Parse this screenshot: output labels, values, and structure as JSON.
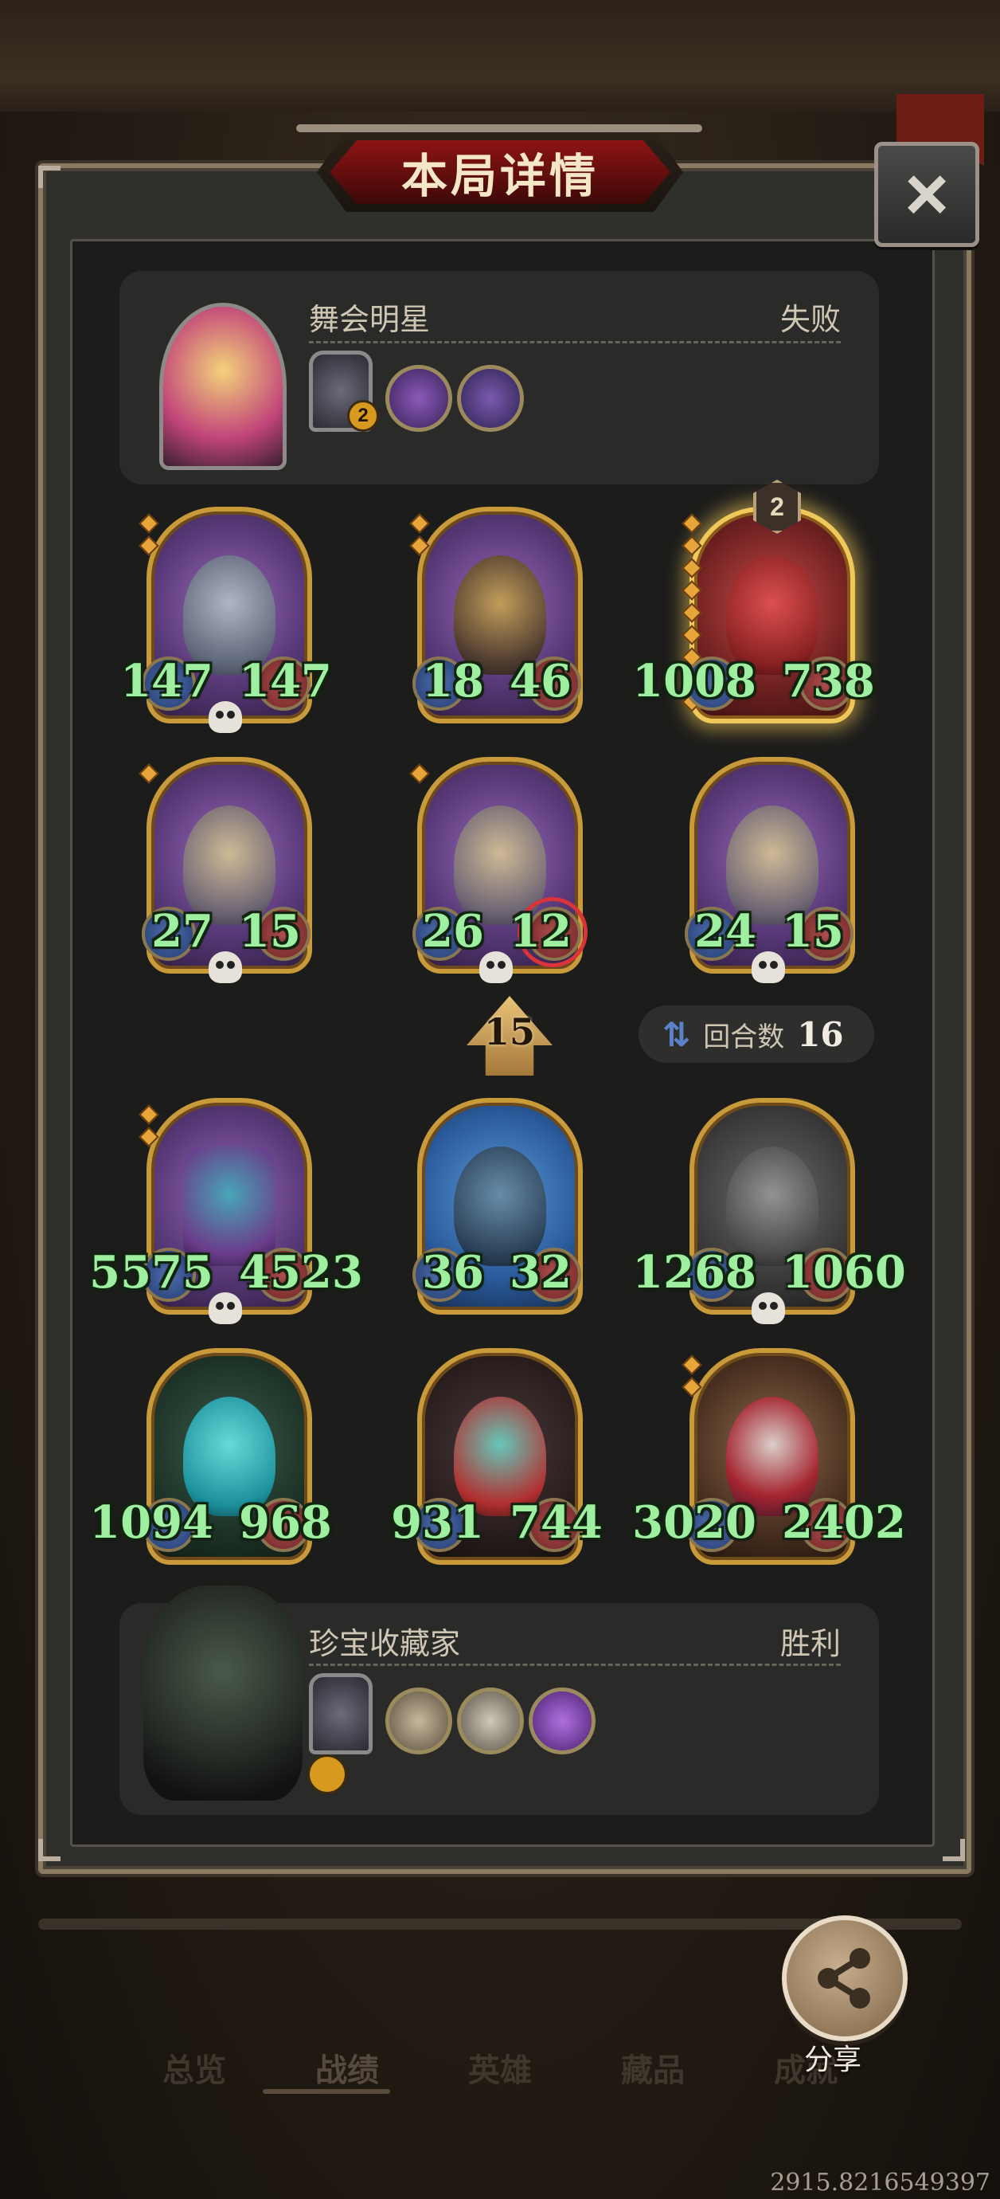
{
  "title": "本局详情",
  "close_label": "×",
  "opponent": {
    "name": "舞会明星",
    "result": "失败",
    "hero_badge": "2",
    "minions": [
      {
        "attack": "147",
        "health": "147",
        "dead": true,
        "stars": 2,
        "golden": false,
        "tier_badge": ""
      },
      {
        "attack": "18",
        "health": "46",
        "dead": false,
        "stars": 2,
        "golden": false,
        "tier_badge": ""
      },
      {
        "attack": "1008",
        "health": "738",
        "dead": false,
        "stars": 10,
        "golden": true,
        "tier_badge": "2"
      },
      {
        "attack": "27",
        "health": "15",
        "dead": true,
        "stars": 1,
        "golden": false,
        "tier_badge": ""
      },
      {
        "attack": "26",
        "health": "12",
        "dead": true,
        "stars": 1,
        "golden": false,
        "tier_badge": "",
        "targeted": true
      },
      {
        "attack": "24",
        "health": "15",
        "dead": true,
        "stars": 1,
        "golden": false,
        "tier_badge": ""
      }
    ]
  },
  "tier_indicator": "15",
  "round": {
    "label": "回合数",
    "value": "16"
  },
  "player": {
    "name": "珍宝收藏家",
    "result": "胜利",
    "minions": [
      {
        "attack": "5575",
        "health": "4523",
        "dead": true,
        "stars": 2
      },
      {
        "attack": "36",
        "health": "32",
        "dead": false,
        "stars": 0
      },
      {
        "attack": "1268",
        "health": "1060",
        "dead": true,
        "stars": 0
      },
      {
        "attack": "1094",
        "health": "968",
        "dead": false,
        "stars": 0
      },
      {
        "attack": "931",
        "health": "744",
        "dead": false,
        "stars": 0
      },
      {
        "attack": "3020",
        "health": "2402",
        "dead": false,
        "stars": 2
      }
    ]
  },
  "nav": {
    "items": [
      "总览",
      "战绩",
      "英雄",
      "藏品",
      "成就"
    ],
    "active": "战绩"
  },
  "share_label": "分享",
  "coordinate_readout": "2915.8216549397",
  "colors": {
    "stat_green": "#9ef0a0",
    "frame_gold": "#c99a3a",
    "banner_red": "#8d1414"
  }
}
